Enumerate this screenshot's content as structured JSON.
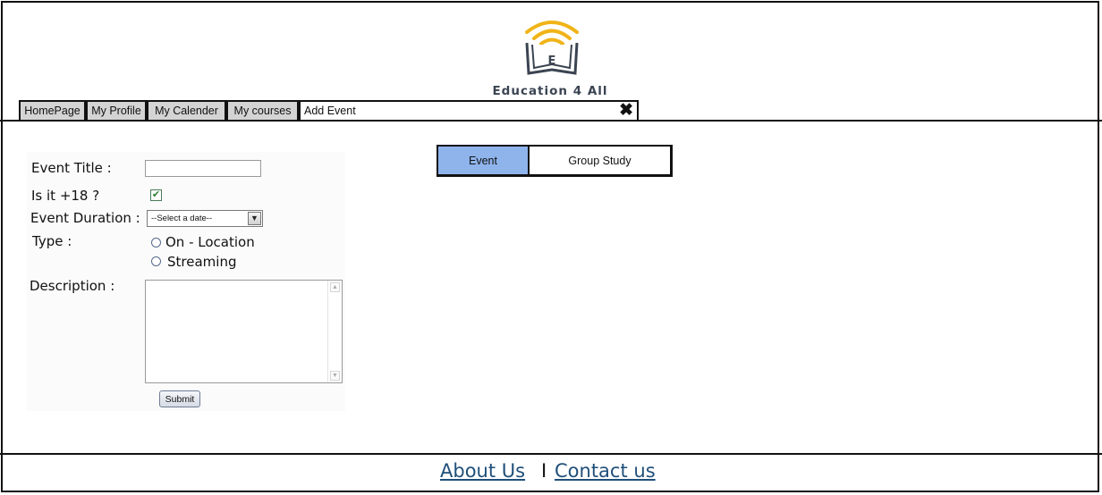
{
  "brand": {
    "name": "Education 4 All",
    "logo_letter": "E",
    "logo_color": "#f0b418"
  },
  "tabs": [
    {
      "label": "HomePage"
    },
    {
      "label": "My Profile"
    },
    {
      "label": "My Calender"
    },
    {
      "label": "My courses"
    },
    {
      "label": "Add Event",
      "close": "✖"
    }
  ],
  "form": {
    "title_label": "Event Title :",
    "title_value": "",
    "age_label": "Is it +18 ?",
    "age_checked": "✔",
    "duration_label": "Event Duration :",
    "duration_select": "--Select a date--",
    "type_label": "Type :",
    "type_options": [
      "On - Location",
      "Streaming"
    ],
    "description_label": "Description :",
    "description_value": "",
    "submit_label": "Submit"
  },
  "segments": {
    "active": "Event",
    "inactive": "Group Study",
    "active_color": "#8fb4ec"
  },
  "footer": {
    "about": "About Us",
    "separator": "I",
    "contact": "Contact us",
    "link_color": "#1f4f7a"
  }
}
